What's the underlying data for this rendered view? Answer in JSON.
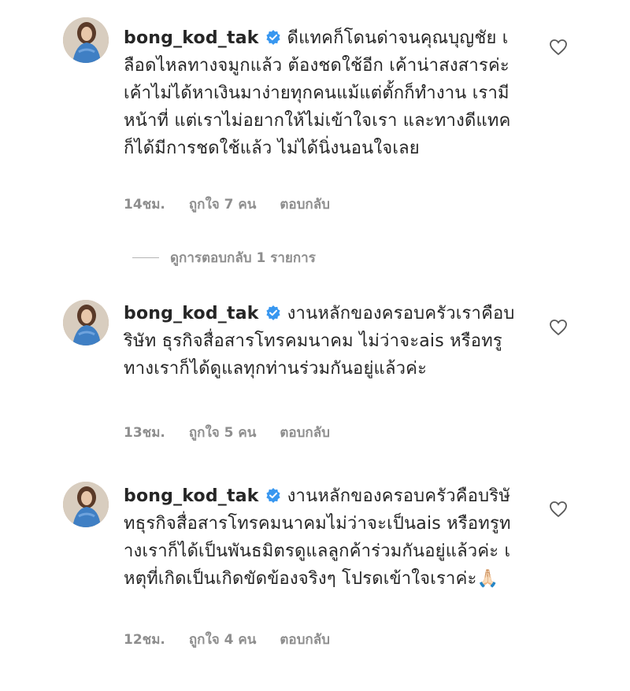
{
  "comments": [
    {
      "username": "bong_kod_tak",
      "text": "ดีแทคก็โดนด่าจนคุณบุญชัย เลือดไหลทางจมูกแล้ว ต้องชดใช้อีก เค้าน่าสงสารค่ะ เค้าไม่ได้หาเงินมาง่ายทุกคนแม้แต่ตั้กก็ทำงาน เรามีหน้าที่ แต่เราไม่อยากให้ไม่เข้าใจเรา และทางดีแทคก็ได้มีการชดใช้แล้ว ไม่ได้นิ่งนอนใจเลย",
      "time": "14ชม.",
      "likes": "ถูกใจ 7 คน",
      "reply": "ตอบกลับ"
    },
    {
      "username": "bong_kod_tak",
      "text": "งานหลักของครอบครัวเราคือบริษัท ธุรกิจสื่อสารโทรคมนาคม ไม่ว่าจะais หรือทรู ทางเราก็ได้ดูแลทุกท่านร่วมกันอยู่แล้วค่ะ",
      "time": "13ชม.",
      "likes": "ถูกใจ 5 คน",
      "reply": "ตอบกลับ"
    },
    {
      "username": "bong_kod_tak",
      "text": "งานหลักของครอบครัวคือบริษัทธุรกิจสื่อสารโทรคมนาคมไม่ว่าจะเป็นais หรือทรูทางเราก็ได้เป็นพันธมิตรดูแลลูกค้าร่วมกันอยู่แล้วค่ะ เหตุที่เกิดเป็นเกิดขัดข้องจริงๆ โปรดเข้าใจเราค่ะ🙏🏻",
      "time": "12ชม.",
      "likes": "ถูกใจ 4 คน",
      "reply": "ตอบกลับ"
    }
  ],
  "view_replies": "ดูการตอบกลับ 1 รายการ",
  "colors": {
    "verified": "#3897f0",
    "meta": "#8e8e8e",
    "text": "#262626"
  }
}
